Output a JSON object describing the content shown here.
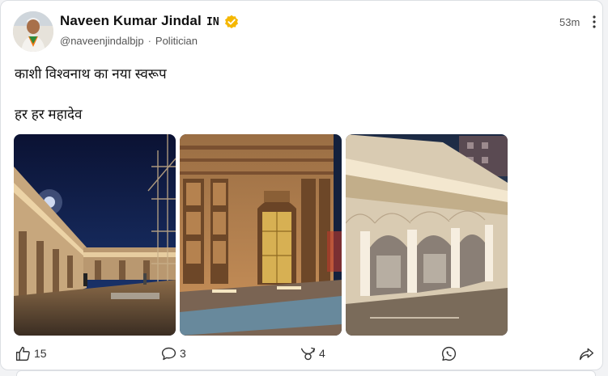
{
  "post": {
    "author_name": "Naveen Kumar Jindal",
    "country_code": "IN",
    "handle": "@naveenjindalbjp",
    "role": "Politician",
    "timestamp": "53m",
    "text_line1": "काशी विश्वनाथ का नया  स्वरूप",
    "text_line2": "हर हर महादेव",
    "images": [
      "temple-night-courtyard",
      "temple-golden-door",
      "temple-arched-corridor"
    ]
  },
  "actions": {
    "like_count": "15",
    "comment_count": "3",
    "repost_count": "4"
  },
  "icons": {
    "verified": "verified-badge-icon",
    "like": "thumbs-up-icon",
    "comment": "comment-icon",
    "repost": "repost-icon",
    "whatsapp": "whatsapp-icon",
    "share": "share-icon"
  },
  "colors": {
    "verified": "#f5b700",
    "text": "#1a1a1a",
    "muted": "#555555"
  }
}
